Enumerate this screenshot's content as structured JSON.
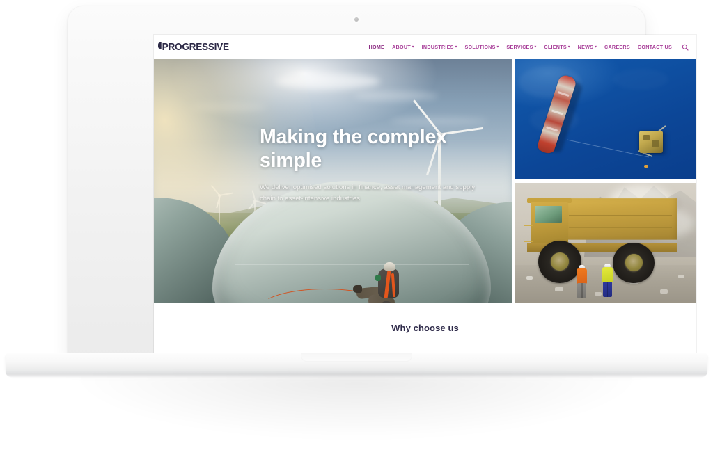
{
  "site": {
    "brand": {
      "name": "PROGRESSIVE",
      "logo_mark": "flag-mark-icon",
      "color": "#2d2a47"
    },
    "nav": {
      "accent_color": "#a9419a",
      "items": [
        {
          "label": "HOME",
          "has_dropdown": false,
          "active": true
        },
        {
          "label": "ABOUT",
          "has_dropdown": true,
          "active": false
        },
        {
          "label": "INDUSTRIES",
          "has_dropdown": true,
          "active": false
        },
        {
          "label": "SOLUTIONS",
          "has_dropdown": true,
          "active": false
        },
        {
          "label": "SERVICES",
          "has_dropdown": true,
          "active": false
        },
        {
          "label": "CLIENTS",
          "has_dropdown": true,
          "active": false
        },
        {
          "label": "NEWS",
          "has_dropdown": true,
          "active": false
        },
        {
          "label": "CAREERS",
          "has_dropdown": false,
          "active": false
        },
        {
          "label": "CONTACT US",
          "has_dropdown": false,
          "active": false
        }
      ],
      "caret_glyph": "▾",
      "search_icon": "search-icon"
    },
    "hero": {
      "heading": "Making the complex simple",
      "subheading": "We deliver optimised solutions in finance, asset management and supply chain to asset-intensive industries",
      "image_alt": "wind-turbine-technician",
      "heading_color": "#ffffff"
    },
    "side_panels": [
      {
        "image_alt": "aerial-tanker-ship-and-offshore-platform"
      },
      {
        "image_alt": "mining-haul-truck-with-workers"
      }
    ],
    "section": {
      "why_choose_title": "Why choose us",
      "title_color": "#2f2b4a"
    }
  },
  "device": {
    "type": "laptop-mockup",
    "webcam": "webcam-dot"
  }
}
